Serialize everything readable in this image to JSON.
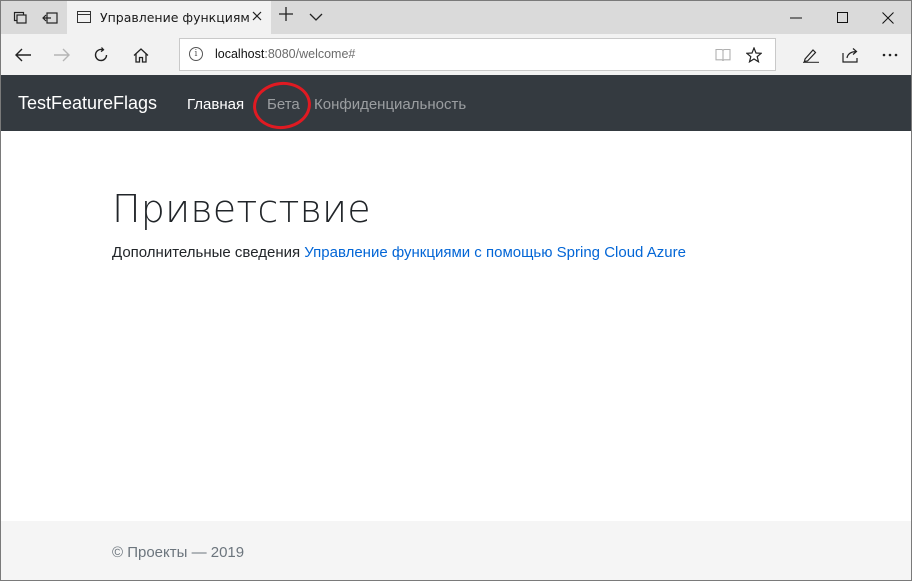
{
  "browser": {
    "tab_title": "Управление функциям",
    "url_host": "localhost",
    "url_rest": ":8080/welcome#"
  },
  "app": {
    "brand": "TestFeatureFlags",
    "nav": {
      "home": "Главная",
      "beta": "Бета",
      "privacy": "Конфиденциальность"
    },
    "highlight_color": "#e01a22",
    "navbar_color": "#343a40"
  },
  "main": {
    "heading": "Приветствие",
    "lead_text": "Дополнительные сведения ",
    "lead_link": "Управление функциями с помощью Spring Cloud Azure",
    "link_color": "#0366d6"
  },
  "footer": {
    "text": "© Проекты — 2019"
  },
  "icons": [
    "tab-preview-icon",
    "set-aside-tabs-icon",
    "page-icon",
    "close-icon",
    "plus-icon",
    "chevron-down-icon",
    "minimize-icon",
    "maximize-icon",
    "close-icon",
    "back-icon",
    "forward-icon",
    "refresh-icon",
    "home-icon",
    "info-icon",
    "reading-view-icon",
    "star-icon",
    "pen-icon",
    "share-icon",
    "more-icon"
  ]
}
